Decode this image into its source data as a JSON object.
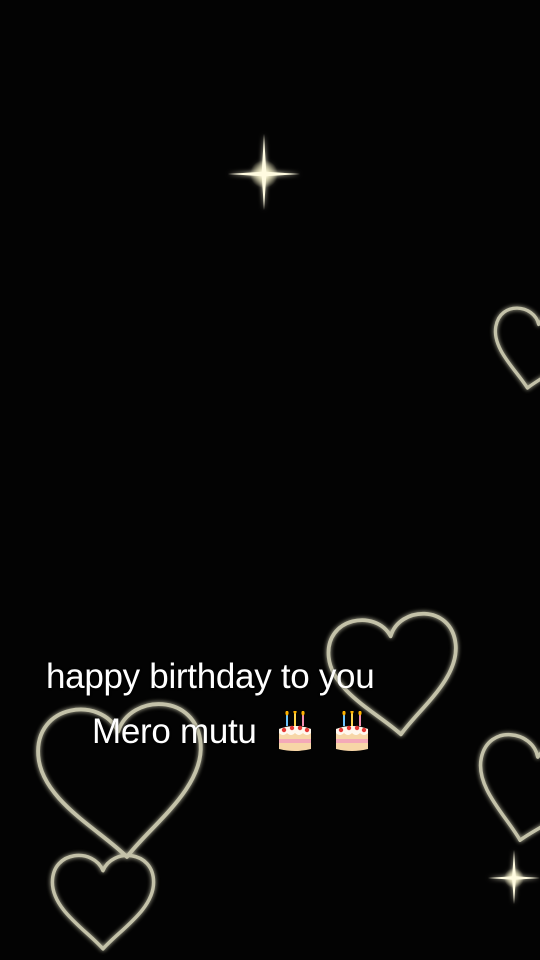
{
  "caption": {
    "line1": "happy birthday to you",
    "line2": "Mero mutu"
  },
  "icons": [
    "birthday-cake-icon",
    "birthday-cake-icon",
    "heart-outline-icon",
    "sparkle-star-icon"
  ],
  "colors": {
    "background": "#030303",
    "text": "#ffffff",
    "heart_glow": "#e8e6c8",
    "sparkle": "#fffbe0"
  }
}
